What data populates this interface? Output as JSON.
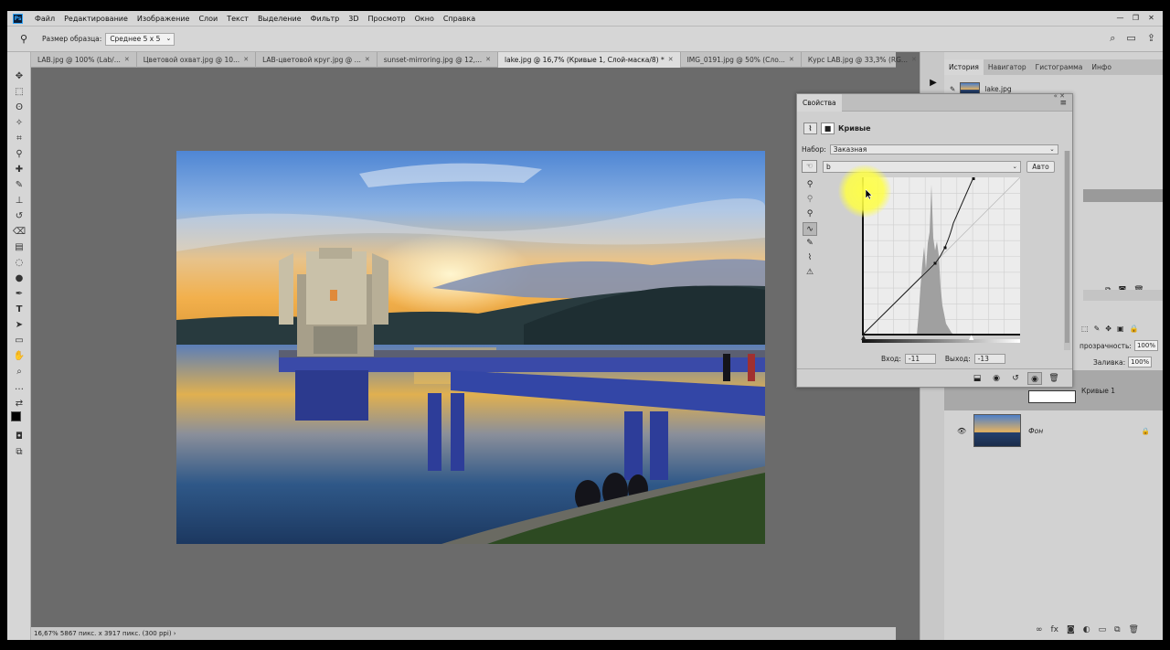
{
  "menu": {
    "items": [
      "Файл",
      "Редактирование",
      "Изображение",
      "Слои",
      "Текст",
      "Выделение",
      "Фильтр",
      "3D",
      "Просмотр",
      "Окно",
      "Справка"
    ],
    "app_icon": "Ps"
  },
  "options": {
    "sample_size_label": "Размер образца:",
    "sample_size_value": "Среднее 5 x 5"
  },
  "tabs": [
    {
      "label": "LAB.jpg @ 100% (Lab/...",
      "active": false
    },
    {
      "label": "Цветовой охват.jpg @ 10...",
      "active": false
    },
    {
      "label": "LAB-цветовой круг.jpg @ ...",
      "active": false
    },
    {
      "label": "sunset-mirroring.jpg @ 12,...",
      "active": false
    },
    {
      "label": "lake.jpg @ 16,7% (Кривые 1, Слой-маска/8) *",
      "active": true
    },
    {
      "label": "IMG_0191.jpg @ 50% (Сло...",
      "active": false
    },
    {
      "label": "Курс LAB.jpg @ 33,3% (RG...",
      "active": false
    }
  ],
  "status": {
    "text": "16,67%  5867 пикс. x 3917 пикс. (300 ppi)  ›"
  },
  "panels": {
    "tabs": [
      "История",
      "Навигатор",
      "Гистограмма",
      "Инфо"
    ],
    "history_item": "lake.jpg",
    "opacity_label": "прозрачность:",
    "opacity_value": "100%",
    "fill_label": "Заливка:",
    "fill_value": "100%",
    "layers": [
      {
        "name": "Кривые 1"
      },
      {
        "name": "Фон"
      }
    ]
  },
  "properties": {
    "tab": "Свойства",
    "title": "Кривые",
    "preset_label": "Набор:",
    "preset_value": "Заказная",
    "channel_value": "b",
    "auto_label": "Авто",
    "input_label": "Вход:",
    "input_value": "-11",
    "output_label": "Выход:",
    "output_value": "-13"
  },
  "colors": {
    "accent": "#31a8ff",
    "highlight": "#ffff46"
  }
}
